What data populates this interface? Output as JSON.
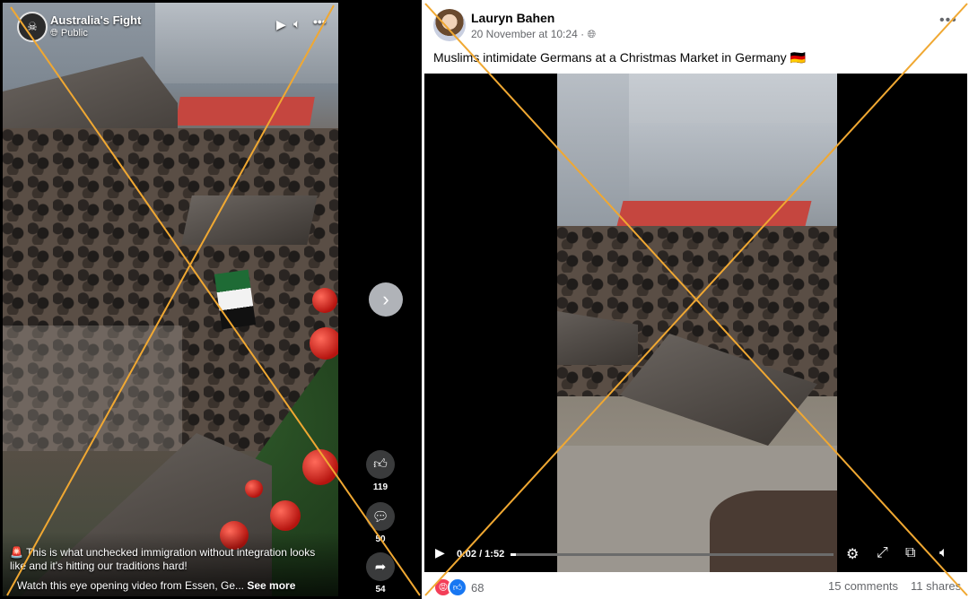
{
  "colors": {
    "overlay_cross": "#f0a832",
    "facebook_blue": "#1877f2",
    "angry_reaction": "#f33e58",
    "text_secondary": "#65676b"
  },
  "reel": {
    "channel_name": "Australia's Fight",
    "audience": "Public",
    "audience_icon": "globe-icon",
    "controls": [
      "play-icon",
      "volume-icon",
      "more-icon"
    ],
    "caption_line": "This is what unchecked immigration without integration looks like and it's hitting our traditions hard!",
    "caption_emoji_icon": "siren-icon",
    "caption_more_text": "Watch this eye opening video from Essen, Ge...",
    "see_more": "See more",
    "likes": "119",
    "comments": "50",
    "shares": "54",
    "next_icon": "chevron-right-icon"
  },
  "post": {
    "author": "Lauryn Bahen",
    "date": "20 November at 10:24",
    "audience_icon": "globe-icon",
    "more_icon": "more-horizontal-icon",
    "text": "Muslims intimidate Germans at a Christmas Market in Germany 🇩🇪",
    "video": {
      "time": "0:02 / 1:52",
      "progress": 0.018,
      "controls": [
        "settings-icon",
        "fullscreen-icon",
        "pip-icon",
        "volume-icon"
      ]
    },
    "reaction_count": "68",
    "comments": "15 comments",
    "shares": "11 shares"
  }
}
